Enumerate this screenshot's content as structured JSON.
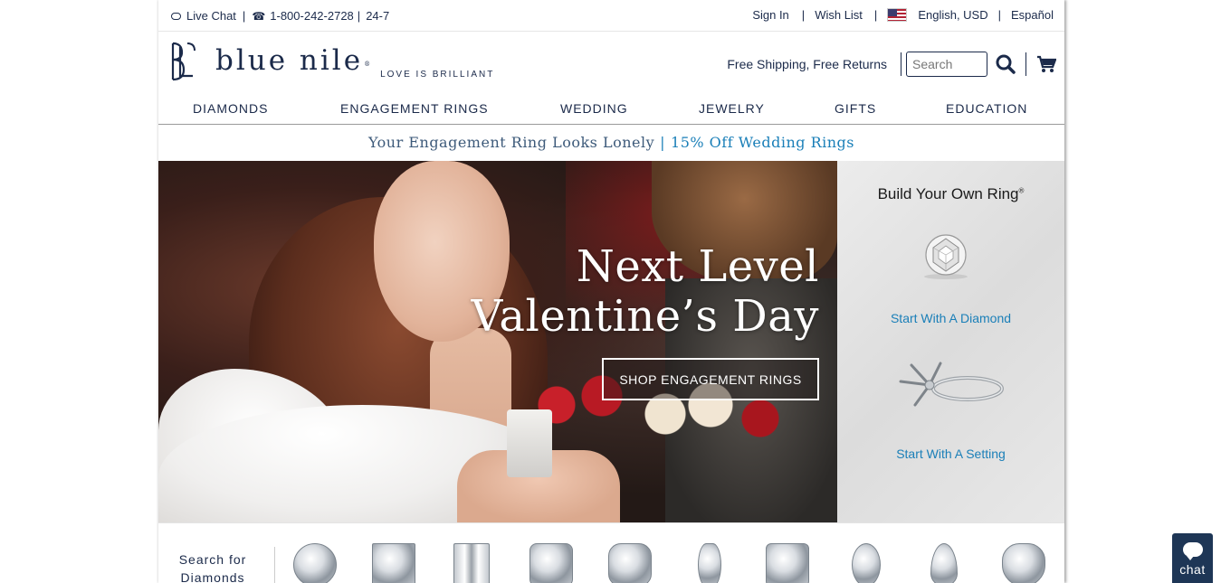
{
  "utility": {
    "live_chat": "Live Chat",
    "phone": "1-800-242-2728",
    "hours": "24-7",
    "sign_in": "Sign In",
    "wish_list": "Wish List",
    "locale": "English, USD",
    "espanol": "Español"
  },
  "header": {
    "brand": "blue nile",
    "reg": "®",
    "tagline": "LOVE IS BRILLIANT",
    "free_shipping": "Free Shipping, Free Returns",
    "search_placeholder": "Search"
  },
  "nav": {
    "items": [
      "DIAMONDS",
      "ENGAGEMENT RINGS",
      "WEDDING",
      "JEWELRY",
      "GIFTS",
      "EDUCATION"
    ]
  },
  "promo": {
    "text": "Your Engagement Ring Looks Lonely",
    "link": "15% Off Wedding Rings"
  },
  "hero": {
    "title_line1": "Next Level",
    "title_line2": "Valentine’s Day",
    "cta": "SHOP ENGAGEMENT RINGS"
  },
  "byo": {
    "title": "Build Your Own Ring",
    "reg": "®",
    "diamond_link": "Start With A Diamond",
    "setting_link": "Start With A Setting"
  },
  "shapes": {
    "label_line1": "Search for",
    "label_line2": "Diamonds"
  },
  "chat_widget": {
    "label": "chat"
  },
  "colors": {
    "navy": "#1b2a4a",
    "link_blue": "#1a7fb8",
    "chat_bg": "#1e3656"
  }
}
